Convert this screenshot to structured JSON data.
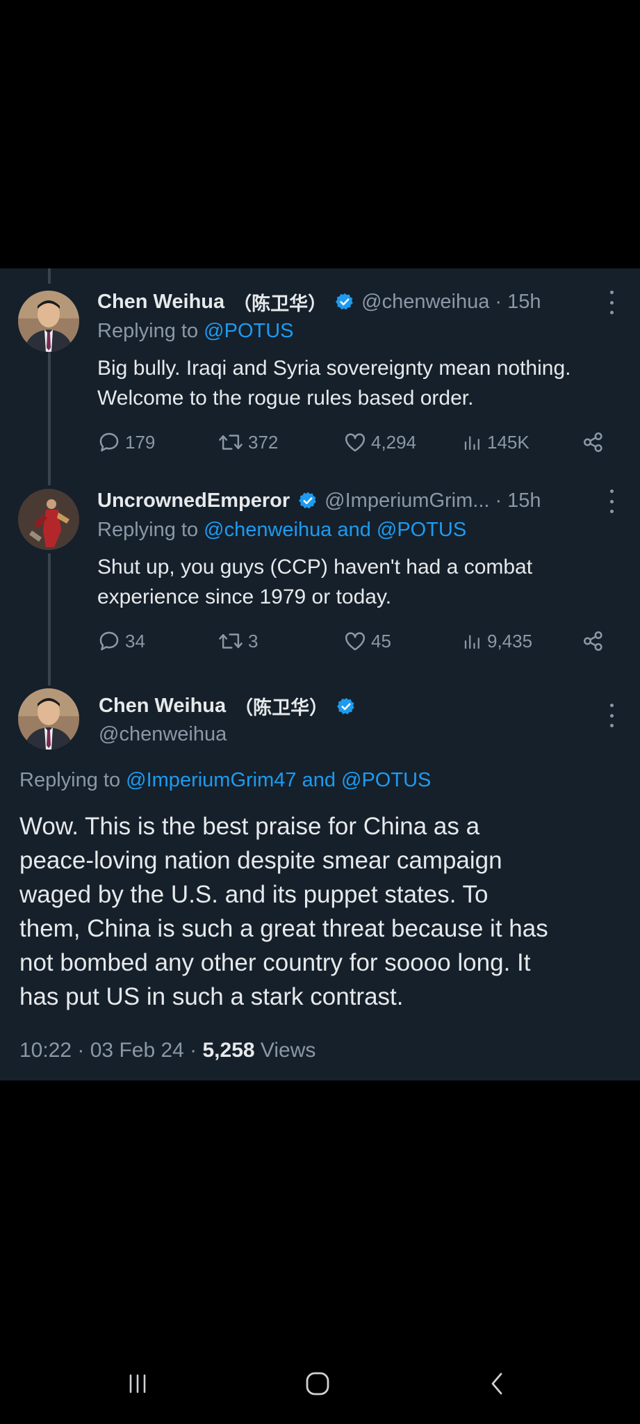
{
  "colors": {
    "panel_bg": "#15202b",
    "text": "#e7e9ea",
    "secondary": "#8b98a5",
    "link": "#1d9bf0",
    "verified": "#1d9bf0",
    "thread_line": "#38444d"
  },
  "tweets": [
    {
      "name": "Chen Weihua",
      "name_cjk": "（陈卫华）",
      "handle": "@chenweihua",
      "sep": "·",
      "time": "15h",
      "replying_prefix": "Replying to ",
      "replying_mentions": "@POTUS",
      "text_lines": [
        "Big bully.  Iraqi and Syria sovereignty mean nothing.",
        "Welcome to the rogue rules based order."
      ],
      "replies": "179",
      "retweets": "372",
      "likes": "4,294",
      "views": "145K"
    },
    {
      "name": "UncrownedEmperor",
      "handle": "@ImperiumGrim...",
      "sep": "·",
      "time": "15h",
      "replying_prefix": "Replying to ",
      "replying_mentions": "@chenweihua and @POTUS",
      "text_lines": [
        "Shut up, you guys (CCP) haven't had a combat",
        "experience since 1979 or today."
      ],
      "replies": "34",
      "retweets": "3",
      "likes": "45",
      "views": "9,435"
    }
  ],
  "main_tweet": {
    "name": "Chen Weihua",
    "name_cjk": "（陈卫华）",
    "handle": "@chenweihua",
    "replying_prefix": "Replying to ",
    "replying_mentions": "@ImperiumGrim47 and @POTUS",
    "text_lines": [
      "Wow. This is the best praise for China as a",
      "peace-loving nation despite smear campaign",
      "waged by the U.S. and its puppet states. To",
      "them, China is such a great threat because it has",
      "not bombed any other country for soooo long. It",
      "has put US in such a stark contrast."
    ],
    "timestamp": "10:22 · 03 Feb 24 · ",
    "views_count": "5,258",
    "views_label": " Views"
  },
  "icons": {
    "reply": "reply-icon",
    "retweet": "retweet-icon",
    "like": "heart-icon",
    "views": "views-icon",
    "share": "share-icon",
    "more": "more-icon",
    "verified": "verified-badge-icon"
  },
  "system_nav": [
    "recent-apps-button",
    "home-button",
    "back-button"
  ]
}
